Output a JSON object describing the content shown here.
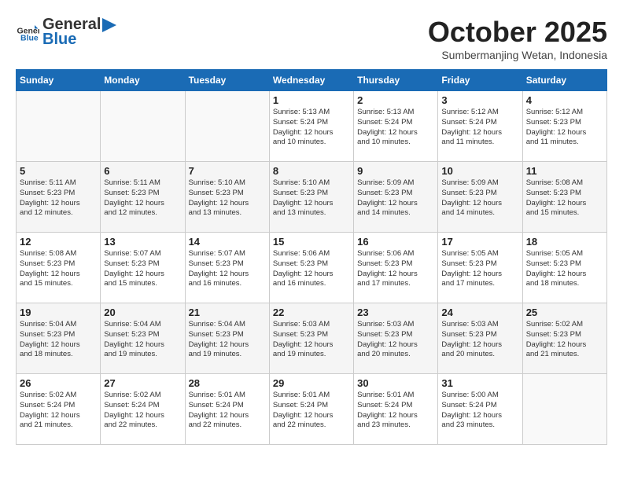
{
  "header": {
    "logo_general": "General",
    "logo_blue": "Blue",
    "month": "October 2025",
    "location": "Sumbermanjing Wetan, Indonesia"
  },
  "days_of_week": [
    "Sunday",
    "Monday",
    "Tuesday",
    "Wednesday",
    "Thursday",
    "Friday",
    "Saturday"
  ],
  "weeks": [
    [
      {
        "day": "",
        "info": ""
      },
      {
        "day": "",
        "info": ""
      },
      {
        "day": "",
        "info": ""
      },
      {
        "day": "1",
        "info": "Sunrise: 5:13 AM\nSunset: 5:24 PM\nDaylight: 12 hours\nand 10 minutes."
      },
      {
        "day": "2",
        "info": "Sunrise: 5:13 AM\nSunset: 5:24 PM\nDaylight: 12 hours\nand 10 minutes."
      },
      {
        "day": "3",
        "info": "Sunrise: 5:12 AM\nSunset: 5:24 PM\nDaylight: 12 hours\nand 11 minutes."
      },
      {
        "day": "4",
        "info": "Sunrise: 5:12 AM\nSunset: 5:23 PM\nDaylight: 12 hours\nand 11 minutes."
      }
    ],
    [
      {
        "day": "5",
        "info": "Sunrise: 5:11 AM\nSunset: 5:23 PM\nDaylight: 12 hours\nand 12 minutes."
      },
      {
        "day": "6",
        "info": "Sunrise: 5:11 AM\nSunset: 5:23 PM\nDaylight: 12 hours\nand 12 minutes."
      },
      {
        "day": "7",
        "info": "Sunrise: 5:10 AM\nSunset: 5:23 PM\nDaylight: 12 hours\nand 13 minutes."
      },
      {
        "day": "8",
        "info": "Sunrise: 5:10 AM\nSunset: 5:23 PM\nDaylight: 12 hours\nand 13 minutes."
      },
      {
        "day": "9",
        "info": "Sunrise: 5:09 AM\nSunset: 5:23 PM\nDaylight: 12 hours\nand 14 minutes."
      },
      {
        "day": "10",
        "info": "Sunrise: 5:09 AM\nSunset: 5:23 PM\nDaylight: 12 hours\nand 14 minutes."
      },
      {
        "day": "11",
        "info": "Sunrise: 5:08 AM\nSunset: 5:23 PM\nDaylight: 12 hours\nand 15 minutes."
      }
    ],
    [
      {
        "day": "12",
        "info": "Sunrise: 5:08 AM\nSunset: 5:23 PM\nDaylight: 12 hours\nand 15 minutes."
      },
      {
        "day": "13",
        "info": "Sunrise: 5:07 AM\nSunset: 5:23 PM\nDaylight: 12 hours\nand 15 minutes."
      },
      {
        "day": "14",
        "info": "Sunrise: 5:07 AM\nSunset: 5:23 PM\nDaylight: 12 hours\nand 16 minutes."
      },
      {
        "day": "15",
        "info": "Sunrise: 5:06 AM\nSunset: 5:23 PM\nDaylight: 12 hours\nand 16 minutes."
      },
      {
        "day": "16",
        "info": "Sunrise: 5:06 AM\nSunset: 5:23 PM\nDaylight: 12 hours\nand 17 minutes."
      },
      {
        "day": "17",
        "info": "Sunrise: 5:05 AM\nSunset: 5:23 PM\nDaylight: 12 hours\nand 17 minutes."
      },
      {
        "day": "18",
        "info": "Sunrise: 5:05 AM\nSunset: 5:23 PM\nDaylight: 12 hours\nand 18 minutes."
      }
    ],
    [
      {
        "day": "19",
        "info": "Sunrise: 5:04 AM\nSunset: 5:23 PM\nDaylight: 12 hours\nand 18 minutes."
      },
      {
        "day": "20",
        "info": "Sunrise: 5:04 AM\nSunset: 5:23 PM\nDaylight: 12 hours\nand 19 minutes."
      },
      {
        "day": "21",
        "info": "Sunrise: 5:04 AM\nSunset: 5:23 PM\nDaylight: 12 hours\nand 19 minutes."
      },
      {
        "day": "22",
        "info": "Sunrise: 5:03 AM\nSunset: 5:23 PM\nDaylight: 12 hours\nand 19 minutes."
      },
      {
        "day": "23",
        "info": "Sunrise: 5:03 AM\nSunset: 5:23 PM\nDaylight: 12 hours\nand 20 minutes."
      },
      {
        "day": "24",
        "info": "Sunrise: 5:03 AM\nSunset: 5:23 PM\nDaylight: 12 hours\nand 20 minutes."
      },
      {
        "day": "25",
        "info": "Sunrise: 5:02 AM\nSunset: 5:23 PM\nDaylight: 12 hours\nand 21 minutes."
      }
    ],
    [
      {
        "day": "26",
        "info": "Sunrise: 5:02 AM\nSunset: 5:24 PM\nDaylight: 12 hours\nand 21 minutes."
      },
      {
        "day": "27",
        "info": "Sunrise: 5:02 AM\nSunset: 5:24 PM\nDaylight: 12 hours\nand 22 minutes."
      },
      {
        "day": "28",
        "info": "Sunrise: 5:01 AM\nSunset: 5:24 PM\nDaylight: 12 hours\nand 22 minutes."
      },
      {
        "day": "29",
        "info": "Sunrise: 5:01 AM\nSunset: 5:24 PM\nDaylight: 12 hours\nand 22 minutes."
      },
      {
        "day": "30",
        "info": "Sunrise: 5:01 AM\nSunset: 5:24 PM\nDaylight: 12 hours\nand 23 minutes."
      },
      {
        "day": "31",
        "info": "Sunrise: 5:00 AM\nSunset: 5:24 PM\nDaylight: 12 hours\nand 23 minutes."
      },
      {
        "day": "",
        "info": ""
      }
    ]
  ]
}
